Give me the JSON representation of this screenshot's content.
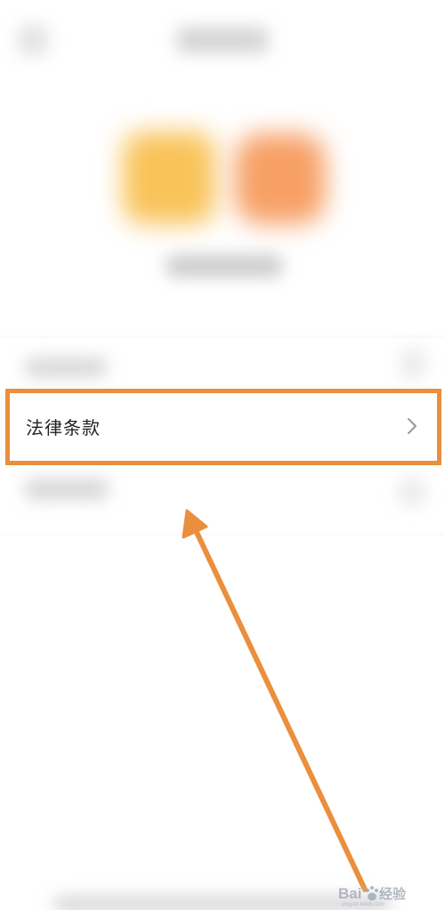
{
  "menu": {
    "legal_terms_label": "法律条款"
  },
  "colors": {
    "highlight": "#ea8f3d",
    "arrow": "#ea8f3d",
    "app_icon_primary": "#f9c35a",
    "app_icon_secondary": "#f7a066"
  },
  "icons": {
    "row_chevron": "chevron-right-icon",
    "annotation": "arrow-up-left-icon"
  },
  "watermark": {
    "brand": "Baidu 经验",
    "url": "jingyan.baidu.com"
  }
}
